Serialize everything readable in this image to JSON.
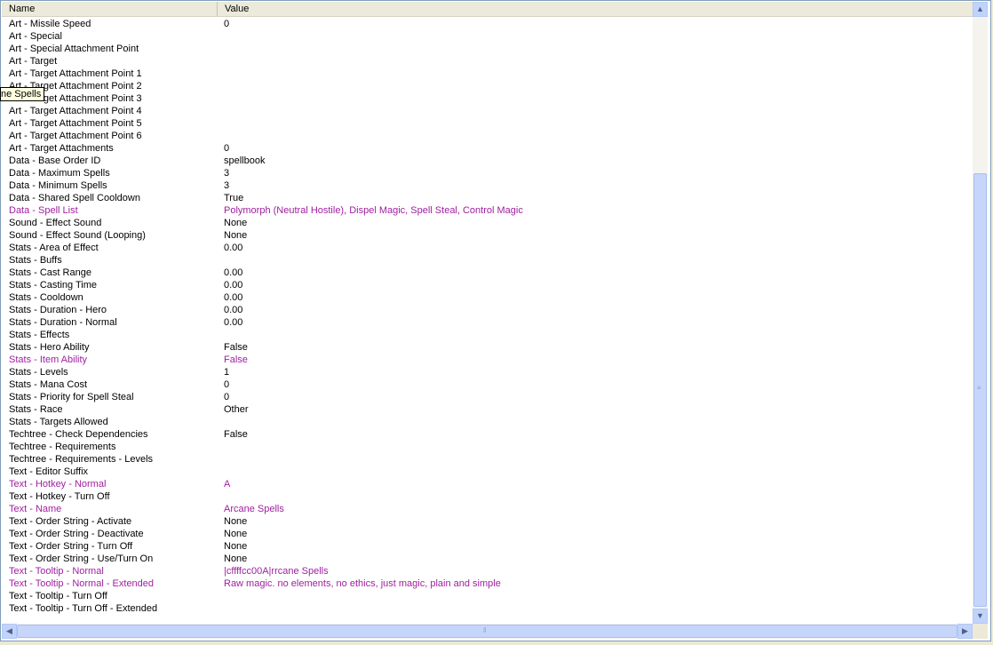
{
  "header": {
    "name_col": "Name",
    "value_col": "Value"
  },
  "tooltip": "ne Spells",
  "rows": [
    {
      "name": "Art - Missile Speed",
      "value": "0",
      "modified": false
    },
    {
      "name": "Art - Special",
      "value": "",
      "modified": false
    },
    {
      "name": "Art - Special Attachment Point",
      "value": "",
      "modified": false
    },
    {
      "name": "Art - Target",
      "value": "",
      "modified": false
    },
    {
      "name": "Art - Target Attachment Point 1",
      "value": "",
      "modified": false
    },
    {
      "name": "Art - Target Attachment Point 2",
      "value": "",
      "modified": false
    },
    {
      "name": "Art - Target Attachment Point 3",
      "value": "",
      "modified": false
    },
    {
      "name": "Art - Target Attachment Point 4",
      "value": "",
      "modified": false
    },
    {
      "name": "Art - Target Attachment Point 5",
      "value": "",
      "modified": false
    },
    {
      "name": "Art - Target Attachment Point 6",
      "value": "",
      "modified": false
    },
    {
      "name": "Art - Target Attachments",
      "value": "0",
      "modified": false
    },
    {
      "name": "Data - Base Order ID",
      "value": "spellbook",
      "modified": false
    },
    {
      "name": "Data - Maximum Spells",
      "value": "3",
      "modified": false
    },
    {
      "name": "Data - Minimum Spells",
      "value": "3",
      "modified": false
    },
    {
      "name": "Data - Shared Spell Cooldown",
      "value": "True",
      "modified": false
    },
    {
      "name": "Data - Spell List",
      "value": "Polymorph (Neutral Hostile), Dispel Magic, Spell Steal, Control Magic",
      "modified": true
    },
    {
      "name": "Sound - Effect Sound",
      "value": "None",
      "modified": false
    },
    {
      "name": "Sound - Effect Sound (Looping)",
      "value": "None",
      "modified": false
    },
    {
      "name": "Stats - Area of Effect",
      "value": "0.00",
      "modified": false
    },
    {
      "name": "Stats - Buffs",
      "value": "",
      "modified": false
    },
    {
      "name": "Stats - Cast Range",
      "value": "0.00",
      "modified": false
    },
    {
      "name": "Stats - Casting Time",
      "value": "0.00",
      "modified": false
    },
    {
      "name": "Stats - Cooldown",
      "value": "0.00",
      "modified": false
    },
    {
      "name": "Stats - Duration - Hero",
      "value": "0.00",
      "modified": false
    },
    {
      "name": "Stats - Duration - Normal",
      "value": "0.00",
      "modified": false
    },
    {
      "name": "Stats - Effects",
      "value": "",
      "modified": false
    },
    {
      "name": "Stats - Hero Ability",
      "value": "False",
      "modified": false
    },
    {
      "name": "Stats - Item Ability",
      "value": "False",
      "modified": true
    },
    {
      "name": "Stats - Levels",
      "value": "1",
      "modified": false
    },
    {
      "name": "Stats - Mana Cost",
      "value": "0",
      "modified": false
    },
    {
      "name": "Stats - Priority for Spell Steal",
      "value": "0",
      "modified": false
    },
    {
      "name": "Stats - Race",
      "value": "Other",
      "modified": false
    },
    {
      "name": "Stats - Targets Allowed",
      "value": "",
      "modified": false
    },
    {
      "name": "Techtree - Check Dependencies",
      "value": "False",
      "modified": false
    },
    {
      "name": "Techtree - Requirements",
      "value": "",
      "modified": false
    },
    {
      "name": "Techtree - Requirements - Levels",
      "value": "",
      "modified": false
    },
    {
      "name": "Text - Editor Suffix",
      "value": "",
      "modified": false
    },
    {
      "name": "Text - Hotkey - Normal",
      "value": "A",
      "modified": true
    },
    {
      "name": "Text - Hotkey - Turn Off",
      "value": "",
      "modified": false
    },
    {
      "name": "Text - Name",
      "value": "Arcane Spells",
      "modified": true
    },
    {
      "name": "Text - Order String - Activate",
      "value": "None",
      "modified": false
    },
    {
      "name": "Text - Order String - Deactivate",
      "value": "None",
      "modified": false
    },
    {
      "name": "Text - Order String - Turn Off",
      "value": "None",
      "modified": false
    },
    {
      "name": "Text - Order String - Use/Turn On",
      "value": "None",
      "modified": false
    },
    {
      "name": "Text - Tooltip - Normal",
      "value": "|cffffcc00A|rrcane Spells",
      "modified": true
    },
    {
      "name": "Text - Tooltip - Normal - Extended",
      "value": "Raw magic. no elements, no ethics, just magic, plain and simple",
      "modified": true
    },
    {
      "name": "Text - Tooltip - Turn Off",
      "value": "",
      "modified": false
    },
    {
      "name": "Text - Tooltip - Turn Off - Extended",
      "value": "",
      "modified": false
    }
  ],
  "scrollbar": {
    "up_icon": "arrow-up-icon",
    "down_icon": "arrow-down-icon",
    "left_icon": "arrow-left-icon",
    "right_icon": "arrow-right-icon"
  },
  "colors": {
    "modified_text": "#a020a0",
    "scrollbar": "#c1d3fb"
  }
}
